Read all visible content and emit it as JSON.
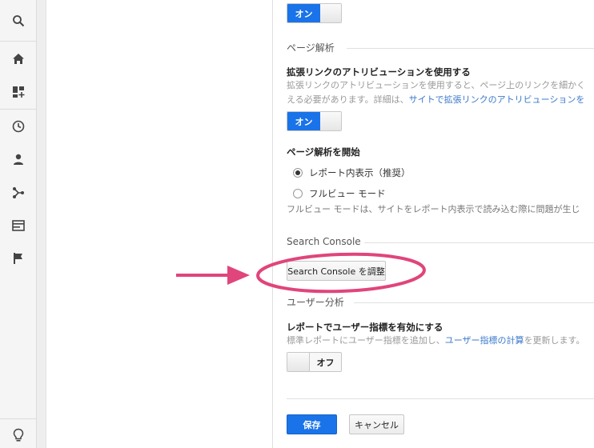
{
  "rail": {
    "items": [
      {
        "name": "search-icon"
      },
      {
        "name": "home-icon"
      },
      {
        "name": "customization-icon"
      },
      {
        "name": "realtime-clock-icon"
      },
      {
        "name": "audience-person-icon"
      },
      {
        "name": "acquisition-icon"
      },
      {
        "name": "behavior-icon"
      },
      {
        "name": "conversions-flag-icon"
      },
      {
        "name": "lightbulb-icon"
      }
    ]
  },
  "toggle_on_label": "オン",
  "toggle_off_label": "オフ",
  "page_analytics": {
    "section_title": "ページ解析",
    "enhanced_link": {
      "title": "拡張リンクのアトリビューションを使用する",
      "desc_line1": "拡張リンクのアトリビューションを使用すると、ページ上のリンクを細かく",
      "desc_line2_prefix": "える必要があります。詳細は、",
      "desc_line2_link": "サイトで拡張リンクのアトリビューションを",
      "state": "on"
    },
    "start": {
      "title": "ページ解析を開始",
      "options": [
        {
          "label": "レポート内表示（推奨）",
          "selected": true
        },
        {
          "label": "フルビュー モード",
          "selected": false
        }
      ],
      "note": "フルビュー モードは、サイトをレポート内表示で読み込む際に問題が生じ"
    }
  },
  "search_console": {
    "section_title": "Search Console",
    "button_label": "Search Console を調整"
  },
  "user_analysis": {
    "section_title": "ユーザー分析",
    "title": "レポートでユーザー指標を有効にする",
    "desc_prefix": "標準レポートにユーザー指標を追加し、",
    "desc_link": "ユーザー指標の計算",
    "desc_suffix": "を更新します。",
    "state": "off"
  },
  "footer": {
    "save_label": "保存",
    "cancel_label": "キャンセル"
  },
  "colors": {
    "accent": "#1a73e8",
    "link": "#3a78c9",
    "annotation": "#e0457b"
  }
}
